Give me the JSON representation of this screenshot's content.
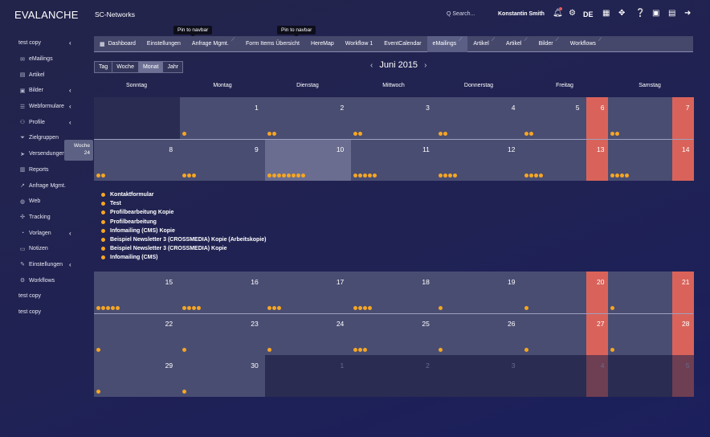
{
  "app": {
    "brand": "EVALANCHE",
    "company": "SC-Networks"
  },
  "header": {
    "search_placeholder": "Q  Search...",
    "user": "Konstantin Smith",
    "lang": "DE",
    "icons": [
      "bell-icon",
      "gear-icon",
      "calendar-icon",
      "move-icon",
      "help-icon",
      "frame-icon",
      "inbox-icon",
      "logout-icon"
    ]
  },
  "tooltips": [
    "Pin to navbar",
    "Pin to navbar"
  ],
  "sidebar": {
    "items": [
      {
        "label": "test copy",
        "icon": "",
        "chevron": true
      },
      {
        "label": "eMailings",
        "icon": "mail-icon"
      },
      {
        "label": "Artikel",
        "icon": "article-icon"
      },
      {
        "label": "Bilder",
        "icon": "image-icon",
        "chevron": true
      },
      {
        "label": "Webformulare",
        "icon": "form-icon",
        "chevron": true
      },
      {
        "label": "Profile",
        "icon": "users-icon",
        "chevron": true
      },
      {
        "label": "Zielgruppen",
        "icon": "filter-icon"
      },
      {
        "label": "Versendungen",
        "icon": "send-icon",
        "chevron": true
      },
      {
        "label": "Reports",
        "icon": "chart-icon"
      },
      {
        "label": "Anfrage Mgmt.",
        "icon": "external-icon"
      },
      {
        "label": "Web",
        "icon": "globe-icon"
      },
      {
        "label": "Tracking",
        "icon": "tracking-icon"
      },
      {
        "label": "Vorlagen",
        "icon": "template-icon",
        "chevron": true
      },
      {
        "label": "Notizen",
        "icon": "note-icon"
      },
      {
        "label": "Einstellungen",
        "icon": "wrench-icon",
        "chevron": true
      },
      {
        "label": "Workflows",
        "icon": "workflow-icon"
      },
      {
        "label": "test copy",
        "icon": ""
      },
      {
        "label": "test copy",
        "icon": ""
      }
    ],
    "week_popup": {
      "label": "Woche",
      "number": "24"
    }
  },
  "navbar": {
    "items": [
      {
        "label": "Dashboard",
        "icon": "dashboard-icon"
      },
      {
        "label": "Einstellungen"
      },
      {
        "label": "Anfrage Mgmt.",
        "pin": true
      },
      {
        "label": "Form Items Übersicht"
      },
      {
        "label": "HereMap"
      },
      {
        "label": "Workflow 1"
      },
      {
        "label": "EventCalendar"
      },
      {
        "label": "eMailings",
        "pin": true,
        "active": true
      },
      {
        "label": "Artikel",
        "pin": true
      },
      {
        "label": "Artikel",
        "pin": true
      },
      {
        "label": "Bilder",
        "pin": true
      },
      {
        "label": "Workflows",
        "pin": true
      }
    ]
  },
  "calendar": {
    "views": [
      "Tag",
      "Woche",
      "Monat",
      "Jahr"
    ],
    "active_view": "Monat",
    "month_title": "Juni 2015",
    "prev": "‹",
    "next": "›",
    "weekdays": [
      "Sonntag",
      "Montag",
      "Dienstag",
      "Mittwoch",
      "Donnerstag",
      "Freitag",
      "Samstag"
    ],
    "weeks": [
      {
        "days": [
          {
            "n": "",
            "other": true
          },
          {
            "n": "1",
            "dots": 1
          },
          {
            "n": "2",
            "dots": 2
          },
          {
            "n": "3",
            "dots": 2
          },
          {
            "n": "4",
            "dots": 2
          },
          {
            "n": "5",
            "dots": 2
          },
          {
            "n": "6",
            "weekend": true
          },
          {
            "n": "",
            "dots": 2
          },
          {
            "n": "7",
            "weekend": true
          }
        ]
      },
      {
        "days": [
          {
            "n": "8",
            "dots": 2
          },
          {
            "n": "9",
            "dots": 3
          },
          {
            "n": "10",
            "dots": 8,
            "today": true
          },
          {
            "n": "11",
            "dots": 5
          },
          {
            "n": "12",
            "dots": 4
          },
          {
            "n": "",
            "dots": 4
          },
          {
            "n": "13",
            "weekend": true
          },
          {
            "n": "",
            "dots": 4
          },
          {
            "n": "14",
            "weekend": true
          }
        ]
      },
      {
        "days": [
          {
            "n": "15",
            "dots": 5
          },
          {
            "n": "16",
            "dots": 4
          },
          {
            "n": "17",
            "dots": 3
          },
          {
            "n": "18",
            "dots": 4
          },
          {
            "n": "19",
            "dots": 1
          },
          {
            "n": "",
            "dots": 1
          },
          {
            "n": "20",
            "weekend": true
          },
          {
            "n": "",
            "dots": 1
          },
          {
            "n": "21",
            "weekend": true
          }
        ]
      },
      {
        "days": [
          {
            "n": "22",
            "dots": 1
          },
          {
            "n": "23",
            "dots": 1
          },
          {
            "n": "24",
            "dots": 1
          },
          {
            "n": "25",
            "dots": 3
          },
          {
            "n": "26",
            "dots": 1
          },
          {
            "n": "",
            "dots": 1
          },
          {
            "n": "27",
            "weekend": true
          },
          {
            "n": "",
            "dots": 1
          },
          {
            "n": "28",
            "weekend": true
          }
        ]
      },
      {
        "days": [
          {
            "n": "29",
            "dots": 1
          },
          {
            "n": "30",
            "dots": 1
          },
          {
            "n": "1",
            "other": true
          },
          {
            "n": "2",
            "other": true
          },
          {
            "n": "3",
            "other": true
          },
          {
            "n": "",
            "other": true
          },
          {
            "n": "4",
            "other": true,
            "weekend": true
          },
          {
            "n": "",
            "other": true
          },
          {
            "n": "5",
            "other": true,
            "weekend": true
          }
        ]
      }
    ],
    "expanded_events": [
      "Kontaktformular",
      "Test",
      "Profilbearbeitung Kopie",
      "Profilbearbeitung",
      "Infomailing (CMS) Kopie",
      "Beispiel Newsletter 3 (CROSSMEDIA) Kopie (Arbeitskopie)",
      "Beispiel Newsletter 3 (CROSSMEDIA) Kopie",
      "Infomailing (CMS)"
    ],
    "colors": {
      "event_dot": "#f5a623",
      "weekend": "#d9635a",
      "cell": "#4a4d72"
    }
  }
}
